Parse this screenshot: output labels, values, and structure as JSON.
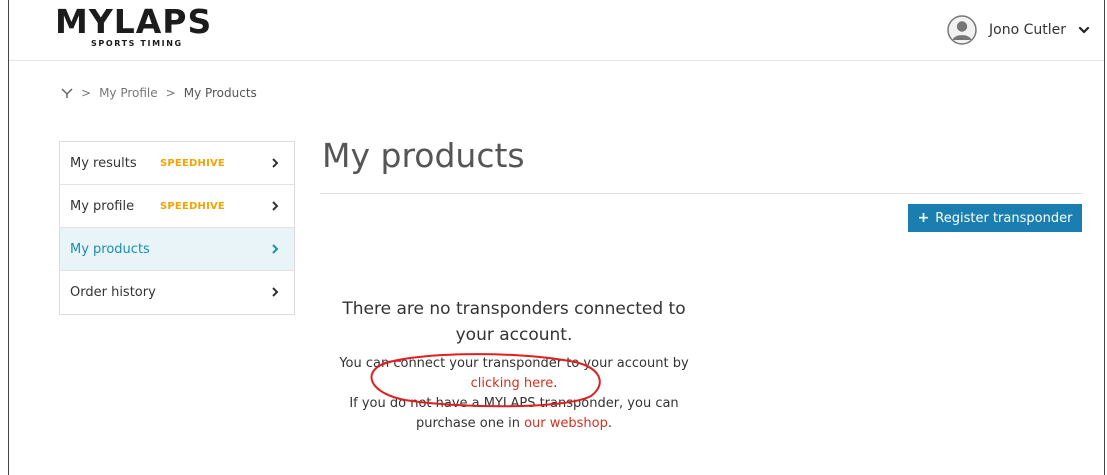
{
  "header": {
    "logo_text": "MYLAPS",
    "logo_subtext": "SPORTS TIMING",
    "user_name": "Jono Cutler"
  },
  "breadcrumb": {
    "sep1": ">",
    "item1": "My Profile",
    "sep2": ">",
    "item2": "My Products"
  },
  "sidebar": {
    "items": [
      {
        "label": "My results",
        "badge": "SPEEDHIVE"
      },
      {
        "label": "My profile",
        "badge": "SPEEDHIVE"
      },
      {
        "label": "My products",
        "badge": ""
      },
      {
        "label": "Order history",
        "badge": ""
      }
    ]
  },
  "main": {
    "title": "My products",
    "register_button": "Register transponder",
    "empty_title": "There are no transponders connected to your account.",
    "connect_text_before": "You can connect your transponder to your account by",
    "connect_link": "clicking here",
    "connect_text_after": ".",
    "shop_text_before": "If you do not have a MYLAPS transponder, you can purchase one in",
    "shop_link": "our webshop",
    "shop_text_after": "."
  },
  "colors": {
    "accent": "#1a7fb0",
    "active_text": "#1a8fae",
    "badge": "#f0a500",
    "link": "#d0311f",
    "annotation": "#e02020"
  },
  "icons": {
    "avatar": "user-avatar-icon",
    "dropdown": "chevron-down-icon",
    "home": "mylaps-home-icon",
    "arrow": "chevron-right-icon",
    "plus": "plus-icon"
  }
}
